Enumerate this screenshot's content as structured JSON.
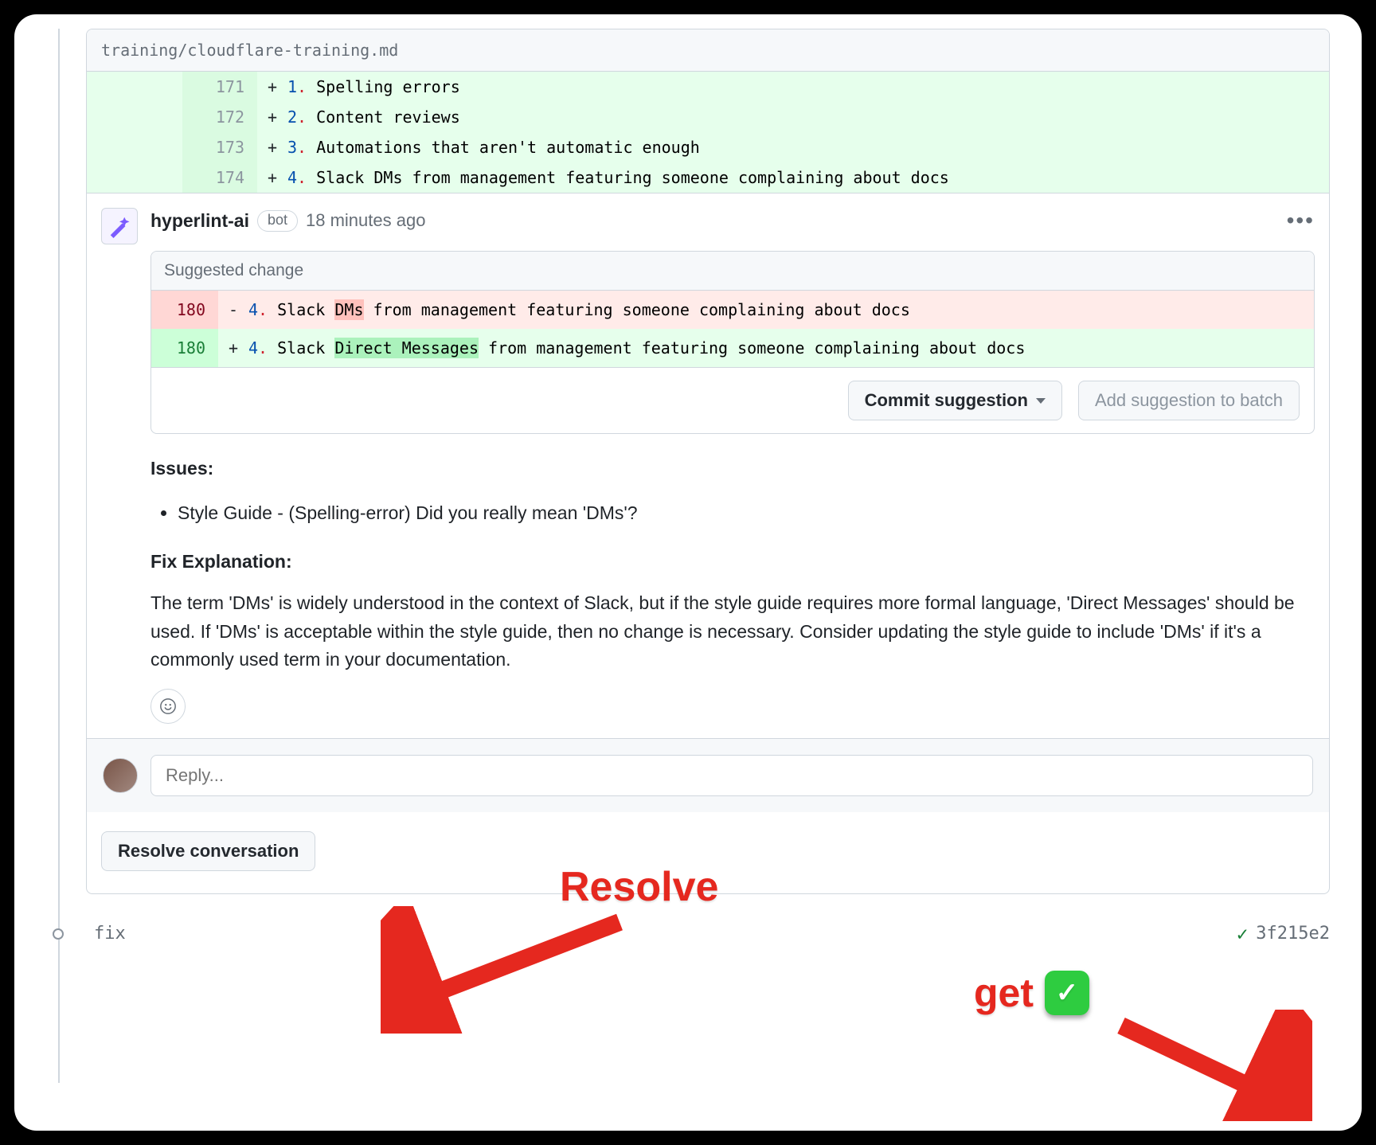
{
  "file_path": "training/cloudflare-training.md",
  "diff_lines": [
    {
      "ln": "171",
      "sign": "+",
      "num": "1",
      "text": "Spelling errors"
    },
    {
      "ln": "172",
      "sign": "+",
      "num": "2",
      "text": "Content reviews"
    },
    {
      "ln": "173",
      "sign": "+",
      "num": "3",
      "text": "Automations that aren't automatic enough"
    },
    {
      "ln": "174",
      "sign": "+",
      "num": "4",
      "text": "Slack DMs from management featuring someone complaining about docs"
    }
  ],
  "comment": {
    "author": "hyperlint-ai",
    "bot_label": "bot",
    "timestamp": "18 minutes ago",
    "suggested_change_label": "Suggested change",
    "suggestion": {
      "old_ln": "180",
      "new_ln": "180",
      "num": "4",
      "prefix": "Slack ",
      "old_hl": "DMs",
      "new_hl": "Direct Messages",
      "suffix": " from management featuring someone complaining about docs"
    },
    "commit_suggestion_label": "Commit suggestion",
    "add_to_batch_label": "Add suggestion to batch",
    "issues_label": "Issues:",
    "issue_item": "Style Guide - (Spelling-error) Did you really mean 'DMs'?",
    "fix_explanation_label": "Fix Explanation:",
    "fix_explanation_body": "The term 'DMs' is widely understood in the context of Slack, but if the style guide requires more formal language, 'Direct Messages' should be used. If 'DMs' is acceptable within the style guide, then no change is necessary. Consider updating the style guide to include 'DMs' if it's a commonly used term in your documentation."
  },
  "reply_placeholder": "Reply...",
  "resolve_label": "Resolve conversation",
  "commit": {
    "message": "fix",
    "sha": "3f215e2"
  },
  "annotations": {
    "resolve": "Resolve",
    "get": "get"
  }
}
